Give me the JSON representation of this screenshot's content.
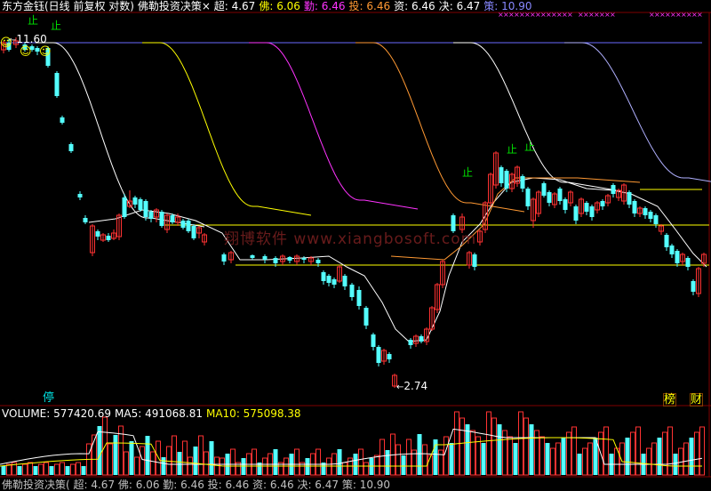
{
  "header": {
    "title": "东方金钰(日线 前复权 对数)",
    "indicator": "佛勒投资决策",
    "close_glyph": "×",
    "items": [
      {
        "label": "超:",
        "value": "4.67",
        "color": "#ffffff"
      },
      {
        "label": "佛:",
        "value": "6.06",
        "color": "#ffff00"
      },
      {
        "label": "勤:",
        "value": "6.46",
        "color": "#ff33ff"
      },
      {
        "label": "投:",
        "value": "6.46",
        "color": "#ff9933"
      },
      {
        "label": "资:",
        "value": "6.46",
        "color": "#ffffff"
      },
      {
        "label": "决:",
        "value": "6.47",
        "color": "#ffffff"
      },
      {
        "label": "策:",
        "value": "10.90",
        "color": "#8888ff"
      }
    ]
  },
  "price_panel": {
    "high_label": "11.60",
    "low_label": "2.74",
    "stop_marks": [
      "止",
      "止",
      "止",
      "止",
      "止"
    ],
    "watermark": "翔博软件 www.xiangbosoft.com",
    "stop_badge": "停",
    "badge_bang": "榜",
    "badge_cai": "财"
  },
  "volume_panel": {
    "items": [
      {
        "label": "VOLUME:",
        "value": "577420.69",
        "color": "#ffffff"
      },
      {
        "label": "MA5:",
        "value": "491068.81",
        "color": "#ffffff"
      },
      {
        "label": "MA10:",
        "value": "575098.38",
        "color": "#ffff00"
      }
    ]
  },
  "footer": {
    "text": "佛勒投资决策(  超: 4.67  佛: 6.06  勤: 6.46  投: 6.46  资: 6.46  决: 6.47  策: 10.90"
  },
  "colors": {
    "up": "#ff3232",
    "down": "#54ffff",
    "grid": "#800000",
    "line_white": "#ffffff",
    "line_yellow": "#ffff00",
    "line_magenta": "#ff33ff",
    "line_orange": "#ff9933",
    "line_blue": "#8888ff"
  },
  "chart_data": {
    "type": "candlestick",
    "price_high": 11.6,
    "price_low": 2.74,
    "volume_values": [
      577420.69,
      491068.81,
      575098.38
    ]
  }
}
